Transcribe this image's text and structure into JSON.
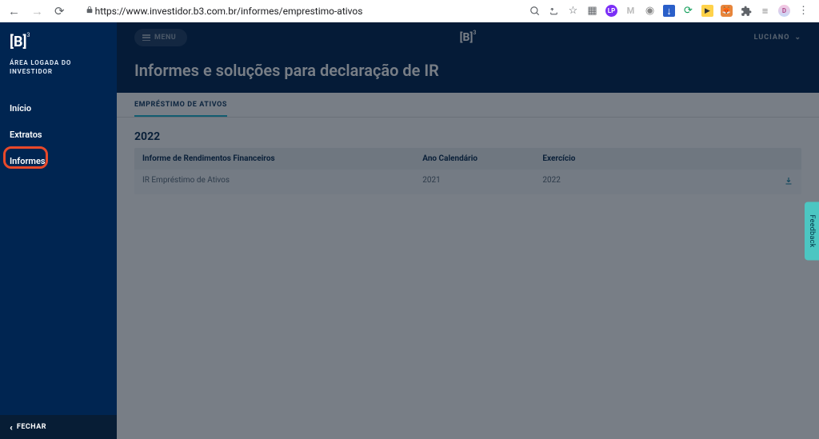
{
  "chrome": {
    "url": "https://www.investidor.b3.com.br/informes/emprestimo-ativos"
  },
  "brand": {
    "logo": "[B]",
    "logo_sup": "3",
    "caption_line1": "ÁREA LOGADA DO",
    "caption_line2": "INVESTIDOR"
  },
  "sidebar": {
    "items": [
      {
        "label": "Início"
      },
      {
        "label": "Extratos"
      },
      {
        "label": "Informes"
      }
    ],
    "close_label": "FECHAR"
  },
  "topbar": {
    "menu_label": "MENU",
    "user_name": "LUCIANO"
  },
  "page": {
    "title": "Informes e soluções para declaração de IR"
  },
  "tabs": [
    {
      "label": "EMPRÉSTIMO DE ATIVOS"
    }
  ],
  "feedback_label": "Feedback",
  "table": {
    "year": "2022",
    "columns": {
      "c1": "Informe de Rendimentos Financeiros",
      "c2": "Ano Calendário",
      "c3": "Exercício"
    },
    "rows": [
      {
        "name": "IR Empréstimo de Ativos",
        "year": "2021",
        "exercise": "2022"
      }
    ]
  }
}
